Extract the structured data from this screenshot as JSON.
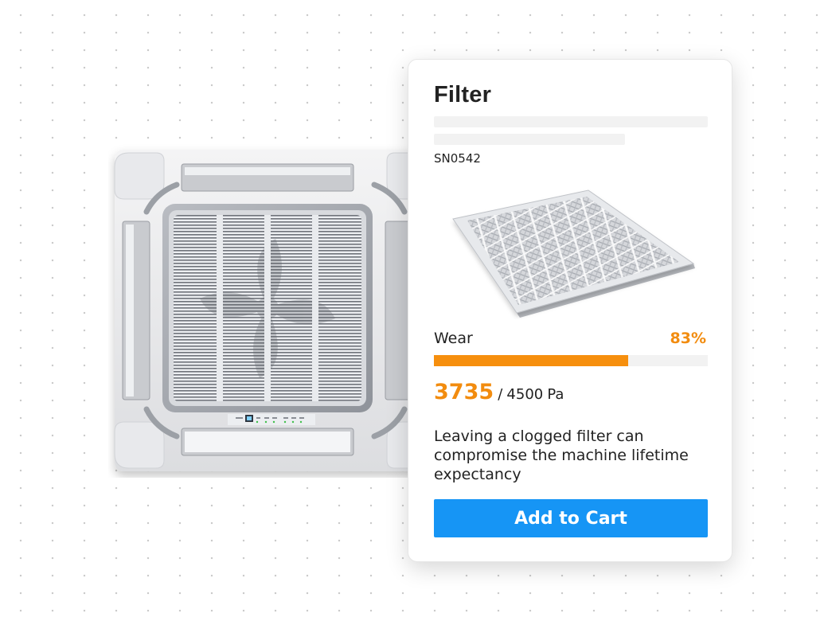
{
  "product": {
    "title": "Filter",
    "serial": "SN0542"
  },
  "wear": {
    "label": "Wear",
    "value_text": "83%",
    "fraction": 0.71,
    "color": "#f68f0e"
  },
  "pressure": {
    "current": "3735",
    "separator": "/",
    "max": "4500",
    "unit": "Pa"
  },
  "description": "Leaving a clogged filter can compromise the machine lifetime expectancy",
  "actions": {
    "add_to_cart_label": "Add to Cart",
    "button_color": "#1695f5"
  },
  "icons": {
    "hero_image": "ceiling-cassette-ac-illustration",
    "product_image": "air-filter-illustration"
  }
}
